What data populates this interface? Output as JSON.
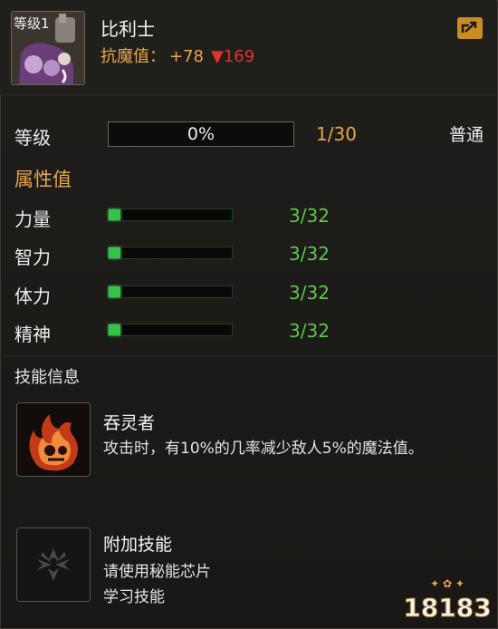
{
  "header": {
    "level_badge": "等级1",
    "name": "比利士",
    "resist_label": "抗魔值：",
    "resist_plus": "+78",
    "resist_down": "▼169"
  },
  "level": {
    "label": "等级",
    "progress_text": "0%",
    "progress_fraction": 0,
    "count": "1/30",
    "rarity": "普通"
  },
  "attributes": {
    "title": "属性值",
    "items": [
      {
        "label": "力量",
        "value": "3/32",
        "fraction": 0.09375
      },
      {
        "label": "智力",
        "value": "3/32",
        "fraction": 0.09375
      },
      {
        "label": "体力",
        "value": "3/32",
        "fraction": 0.09375
      },
      {
        "label": "精神",
        "value": "3/32",
        "fraction": 0.09375
      }
    ]
  },
  "skills": {
    "title": "技能信息",
    "items": [
      {
        "name": "吞灵者",
        "desc": [
          "攻击时，有10%的几率减少敌人5%的魔法值。"
        ]
      },
      {
        "name": "附加技能",
        "desc": [
          "请使用秘能芯片",
          "学习技能"
        ]
      }
    ]
  },
  "watermark": {
    "text": "18183"
  },
  "colors": {
    "accent": "#e8a64a",
    "stat_green": "#5dc64c",
    "down_red": "#e0332d"
  }
}
